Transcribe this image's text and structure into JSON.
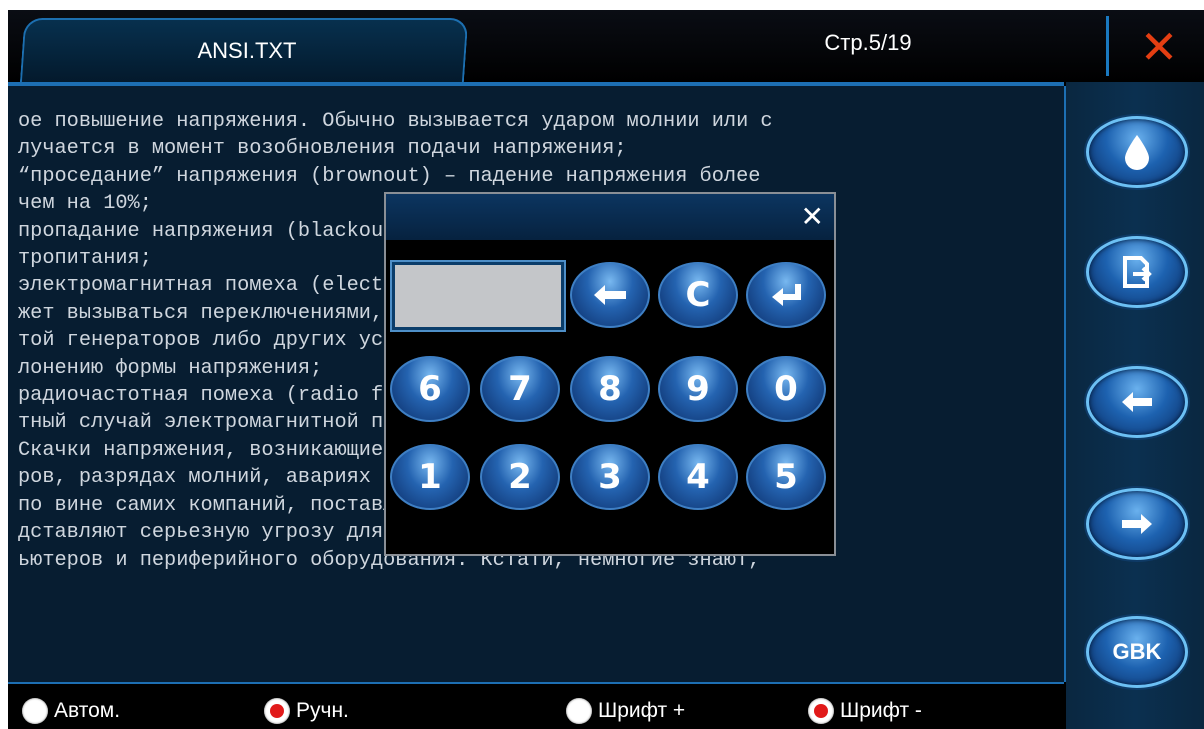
{
  "header": {
    "file_name": "ANSI.TXT",
    "page_indicator": "Стр.5/19",
    "close_icon": "close-x-icon"
  },
  "text_lines": [
    "ое повышение напряжения. Обычно вызывается ударом молнии или с",
    "лучается в момент возобновления подачи напряжения;",
    "“проседание” напряжения (brownout) – падение напряжения более",
    "чем на 10%;",
    "пропадание напряжения (blackout) – полное отключение сети элек",
    "тропитания;",
    "электромагнитная помеха (electromagnetic interference, EMI) мо",
    "жет вызываться переключениями, атмосферным разрядом, рабо",
    "той генераторов либо других устройств, и приводит к отк",
    "лонению формы напряжения;",
    "радиочастотная помеха (radio frequency interference, RFI) – час",
    "тный случай электромагнитной помехи.",
    "Скачки напряжения, возникающие при включении электроприбо",
    "ров, разрядах молний, авариях на подстанциях, а иногда и",
    "по вине самих компаний, поставляющих в дома электричество, пре",
    "дставляют серьезную угрозу для нашей дорогой электроники, комп",
    "ьютеров и периферийного оборудования. Кстати, немногие знают,"
  ],
  "sidebar": {
    "buttons": [
      {
        "icon": "water-drop-icon"
      },
      {
        "icon": "export-file-icon"
      },
      {
        "icon": "arrow-left-icon"
      },
      {
        "icon": "arrow-right-icon"
      },
      {
        "label": "GBK"
      }
    ]
  },
  "bottom_bar": {
    "options": [
      {
        "label": "Автом.",
        "selected": false
      },
      {
        "label": "Ручн.",
        "selected": true
      },
      {
        "label": "Шрифт +",
        "selected": false
      },
      {
        "label": "Шрифт -",
        "selected": true
      }
    ]
  },
  "keypad": {
    "input_value": "",
    "close_icon": "close-x-icon",
    "control_keys": [
      "backspace-icon",
      "C",
      "enter-icon"
    ],
    "row1": [
      "6",
      "7",
      "8",
      "9",
      "0"
    ],
    "row2": [
      "1",
      "2",
      "3",
      "4",
      "5"
    ]
  }
}
